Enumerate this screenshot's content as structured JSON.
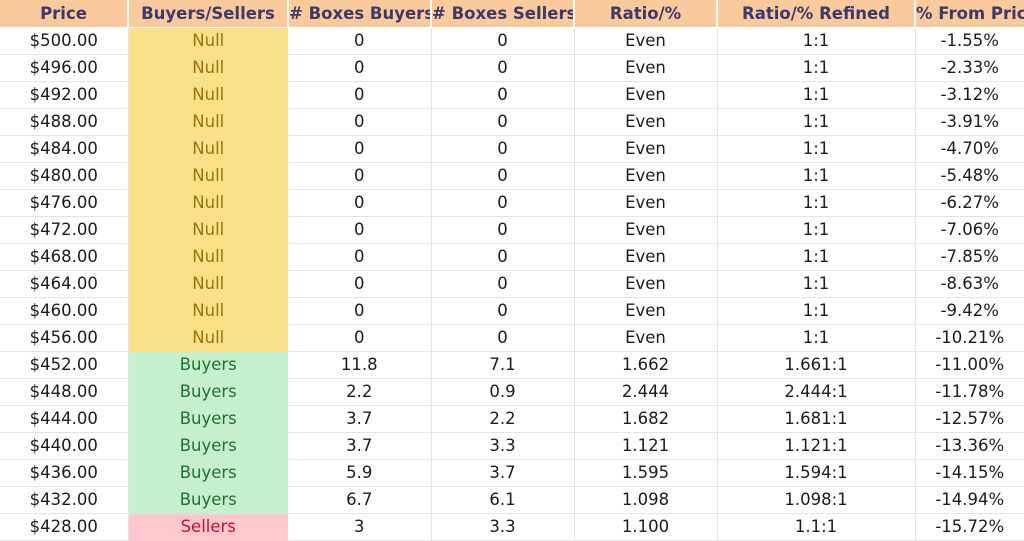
{
  "table": {
    "columns": [
      {
        "key": "price",
        "label": "Price"
      },
      {
        "key": "state",
        "label": "Buyers/Sellers"
      },
      {
        "key": "boxesBuyers",
        "label": "# Boxes Buyers"
      },
      {
        "key": "boxesSellers",
        "label": "# Boxes Sellers"
      },
      {
        "key": "ratio",
        "label": "Ratio/%"
      },
      {
        "key": "refined",
        "label": "Ratio/% Refined"
      },
      {
        "key": "fromPrice",
        "label": "% From Price"
      }
    ],
    "rows": [
      {
        "price": "$500.00",
        "state": "Null",
        "boxesBuyers": "0",
        "boxesSellers": "0",
        "ratio": "Even",
        "refined": "1:1",
        "fromPrice": "-1.55%"
      },
      {
        "price": "$496.00",
        "state": "Null",
        "boxesBuyers": "0",
        "boxesSellers": "0",
        "ratio": "Even",
        "refined": "1:1",
        "fromPrice": "-2.33%"
      },
      {
        "price": "$492.00",
        "state": "Null",
        "boxesBuyers": "0",
        "boxesSellers": "0",
        "ratio": "Even",
        "refined": "1:1",
        "fromPrice": "-3.12%"
      },
      {
        "price": "$488.00",
        "state": "Null",
        "boxesBuyers": "0",
        "boxesSellers": "0",
        "ratio": "Even",
        "refined": "1:1",
        "fromPrice": "-3.91%"
      },
      {
        "price": "$484.00",
        "state": "Null",
        "boxesBuyers": "0",
        "boxesSellers": "0",
        "ratio": "Even",
        "refined": "1:1",
        "fromPrice": "-4.70%"
      },
      {
        "price": "$480.00",
        "state": "Null",
        "boxesBuyers": "0",
        "boxesSellers": "0",
        "ratio": "Even",
        "refined": "1:1",
        "fromPrice": "-5.48%"
      },
      {
        "price": "$476.00",
        "state": "Null",
        "boxesBuyers": "0",
        "boxesSellers": "0",
        "ratio": "Even",
        "refined": "1:1",
        "fromPrice": "-6.27%"
      },
      {
        "price": "$472.00",
        "state": "Null",
        "boxesBuyers": "0",
        "boxesSellers": "0",
        "ratio": "Even",
        "refined": "1:1",
        "fromPrice": "-7.06%"
      },
      {
        "price": "$468.00",
        "state": "Null",
        "boxesBuyers": "0",
        "boxesSellers": "0",
        "ratio": "Even",
        "refined": "1:1",
        "fromPrice": "-7.85%"
      },
      {
        "price": "$464.00",
        "state": "Null",
        "boxesBuyers": "0",
        "boxesSellers": "0",
        "ratio": "Even",
        "refined": "1:1",
        "fromPrice": "-8.63%"
      },
      {
        "price": "$460.00",
        "state": "Null",
        "boxesBuyers": "0",
        "boxesSellers": "0",
        "ratio": "Even",
        "refined": "1:1",
        "fromPrice": "-9.42%"
      },
      {
        "price": "$456.00",
        "state": "Null",
        "boxesBuyers": "0",
        "boxesSellers": "0",
        "ratio": "Even",
        "refined": "1:1",
        "fromPrice": "-10.21%"
      },
      {
        "price": "$452.00",
        "state": "Buyers",
        "boxesBuyers": "11.8",
        "boxesSellers": "7.1",
        "ratio": "1.662",
        "refined": "1.661:1",
        "fromPrice": "-11.00%"
      },
      {
        "price": "$448.00",
        "state": "Buyers",
        "boxesBuyers": "2.2",
        "boxesSellers": "0.9",
        "ratio": "2.444",
        "refined": "2.444:1",
        "fromPrice": "-11.78%"
      },
      {
        "price": "$444.00",
        "state": "Buyers",
        "boxesBuyers": "3.7",
        "boxesSellers": "2.2",
        "ratio": "1.682",
        "refined": "1.681:1",
        "fromPrice": "-12.57%"
      },
      {
        "price": "$440.00",
        "state": "Buyers",
        "boxesBuyers": "3.7",
        "boxesSellers": "3.3",
        "ratio": "1.121",
        "refined": "1.121:1",
        "fromPrice": "-13.36%"
      },
      {
        "price": "$436.00",
        "state": "Buyers",
        "boxesBuyers": "5.9",
        "boxesSellers": "3.7",
        "ratio": "1.595",
        "refined": "1.594:1",
        "fromPrice": "-14.15%"
      },
      {
        "price": "$432.00",
        "state": "Buyers",
        "boxesBuyers": "6.7",
        "boxesSellers": "6.1",
        "ratio": "1.098",
        "refined": "1.098:1",
        "fromPrice": "-14.94%"
      },
      {
        "price": "$428.00",
        "state": "Sellers",
        "boxesBuyers": "3",
        "boxesSellers": "3.3",
        "ratio": "1.100",
        "refined": "1.1:1",
        "fromPrice": "-15.72%"
      }
    ]
  },
  "colors": {
    "header_background": "#FBCA9C",
    "header_text": "#3A3A6E",
    "null_background": "#FBE08A",
    "null_text": "#9A7410",
    "buyers_background": "#C6EFCE",
    "buyers_text": "#1D7230",
    "sellers_background": "#FFC7CE",
    "sellers_text": "#C3122E",
    "gridline": "#E3E3E3",
    "cell_text": "#1B1B1B"
  }
}
